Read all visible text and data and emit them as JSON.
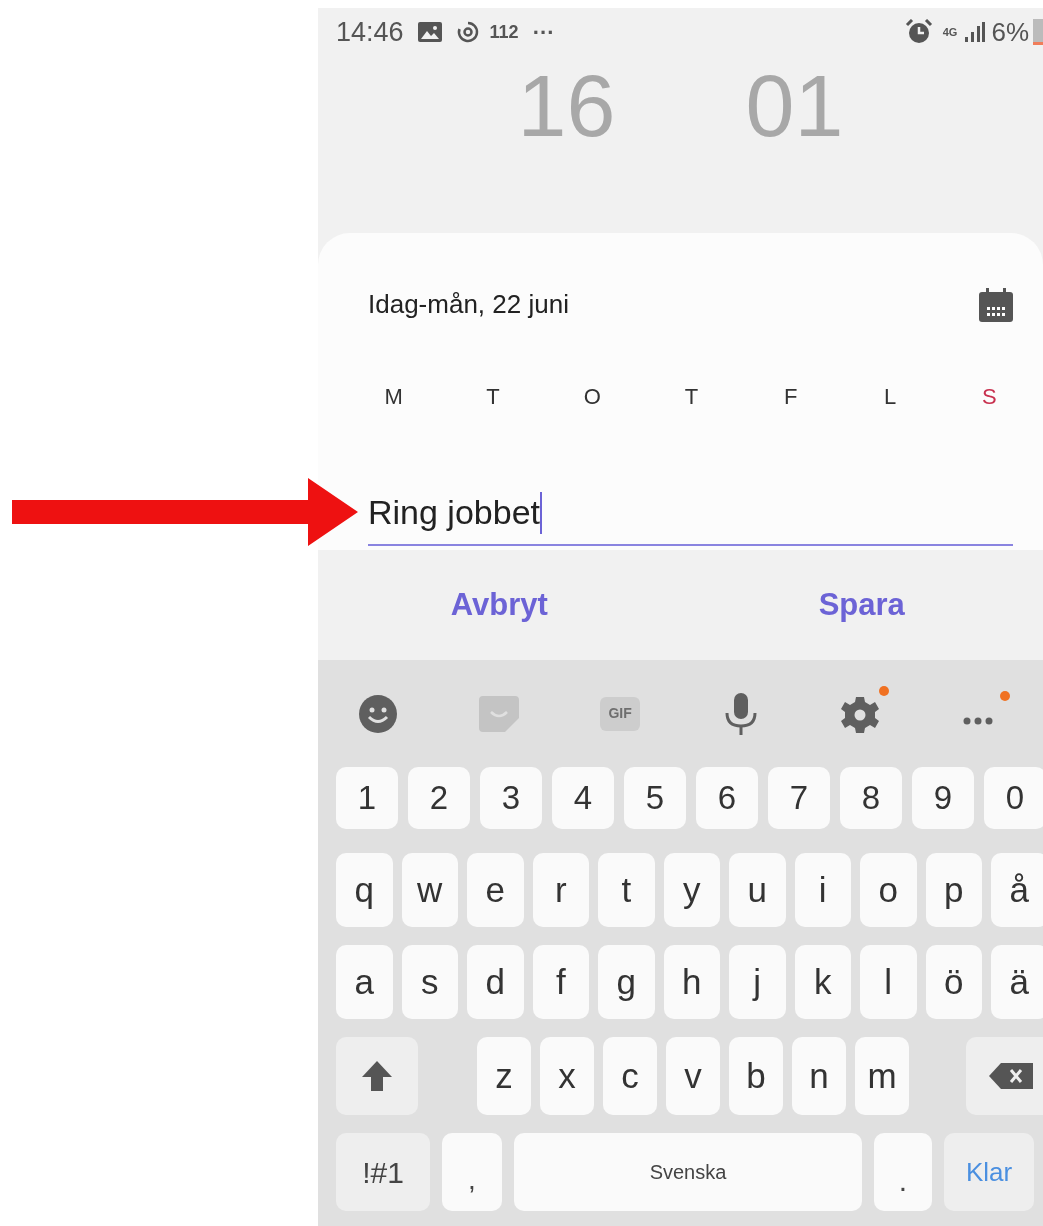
{
  "status_bar": {
    "time": "14:46",
    "notification_count": "112",
    "more": "···",
    "network": "4G",
    "battery": "6%"
  },
  "time_picker": {
    "hour": "16",
    "minute": "01"
  },
  "alarm_card": {
    "date": "Idag-mån, 22 juni",
    "weekdays": [
      {
        "label": "M",
        "color": "#333333"
      },
      {
        "label": "T",
        "color": "#333333"
      },
      {
        "label": "O",
        "color": "#333333"
      },
      {
        "label": "T",
        "color": "#333333"
      },
      {
        "label": "F",
        "color": "#333333"
      },
      {
        "label": "L",
        "color": "#333333"
      },
      {
        "label": "S",
        "color": "#c8314f"
      }
    ],
    "name_field": {
      "value": "Ring jobbet"
    }
  },
  "actions": [
    "Avbryt",
    "Spara"
  ],
  "keyboard": {
    "toolbar": [
      {
        "kind": "emoji",
        "disabled": false,
        "dot": false
      },
      {
        "kind": "sticker",
        "disabled": true,
        "dot": false
      },
      {
        "kind": "gif",
        "label": "GIF",
        "disabled": true,
        "dot": false
      },
      {
        "kind": "mic",
        "disabled": false,
        "dot": false
      },
      {
        "kind": "settings",
        "disabled": false,
        "dot": true
      },
      {
        "kind": "more",
        "disabled": false,
        "dot": true
      }
    ],
    "number_row": [
      "1",
      "2",
      "3",
      "4",
      "5",
      "6",
      "7",
      "8",
      "9",
      "0"
    ],
    "row_1": [
      "q",
      "w",
      "e",
      "r",
      "t",
      "y",
      "u",
      "i",
      "o",
      "p",
      "å"
    ],
    "row_2": [
      "a",
      "s",
      "d",
      "f",
      "g",
      "h",
      "j",
      "k",
      "l",
      "ö",
      "ä"
    ],
    "row_3": [
      "z",
      "x",
      "c",
      "v",
      "b",
      "n",
      "m"
    ],
    "symbols_key": "!#1",
    "comma_key": ",",
    "space_key": "Svenska",
    "period_key": ".",
    "done_key": "Klar"
  }
}
